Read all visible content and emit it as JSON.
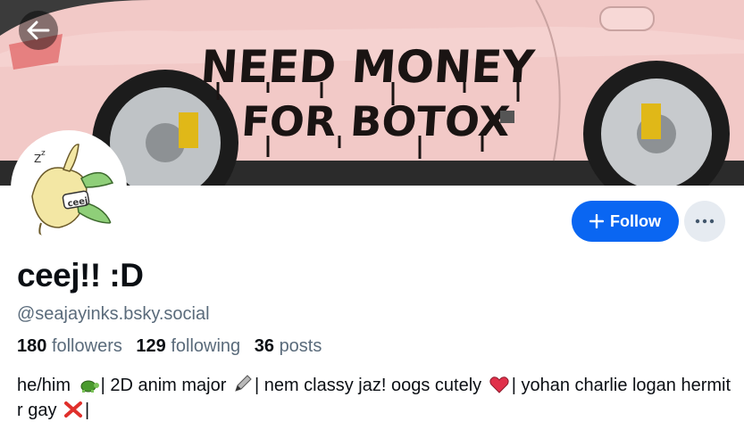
{
  "banner": {
    "slogan_line1": "NEED MONEY",
    "slogan_line2": "FOR BOTOX",
    "car_color": "#f2c9c7"
  },
  "header": {
    "back_icon": "arrow-left-icon"
  },
  "profile": {
    "display_name": "ceej!! :D",
    "handle": "@seajayinks.bsky.social",
    "avatar_text": "ceej",
    "stats": {
      "followers_count": "180",
      "followers_label": "followers",
      "following_count": "129",
      "following_label": "following",
      "posts_count": "36",
      "posts_label": "posts"
    },
    "bio": {
      "p1": "he/him",
      "p2": "| 2D anim major",
      "p3": "| nem classy jaz! oogs cutely",
      "p4": "| yohan charlie logan hermit r gay",
      "p5": "|",
      "emoji_1": "turtle-emoji",
      "emoji_2": "pencil-emoji",
      "emoji_3": "heart-emoji",
      "emoji_4": "cross-mark-emoji"
    }
  },
  "actions": {
    "follow_label": "Follow",
    "follow_icon": "plus-icon",
    "more_icon": "ellipsis-icon",
    "follow_color": "#0a66f2"
  }
}
